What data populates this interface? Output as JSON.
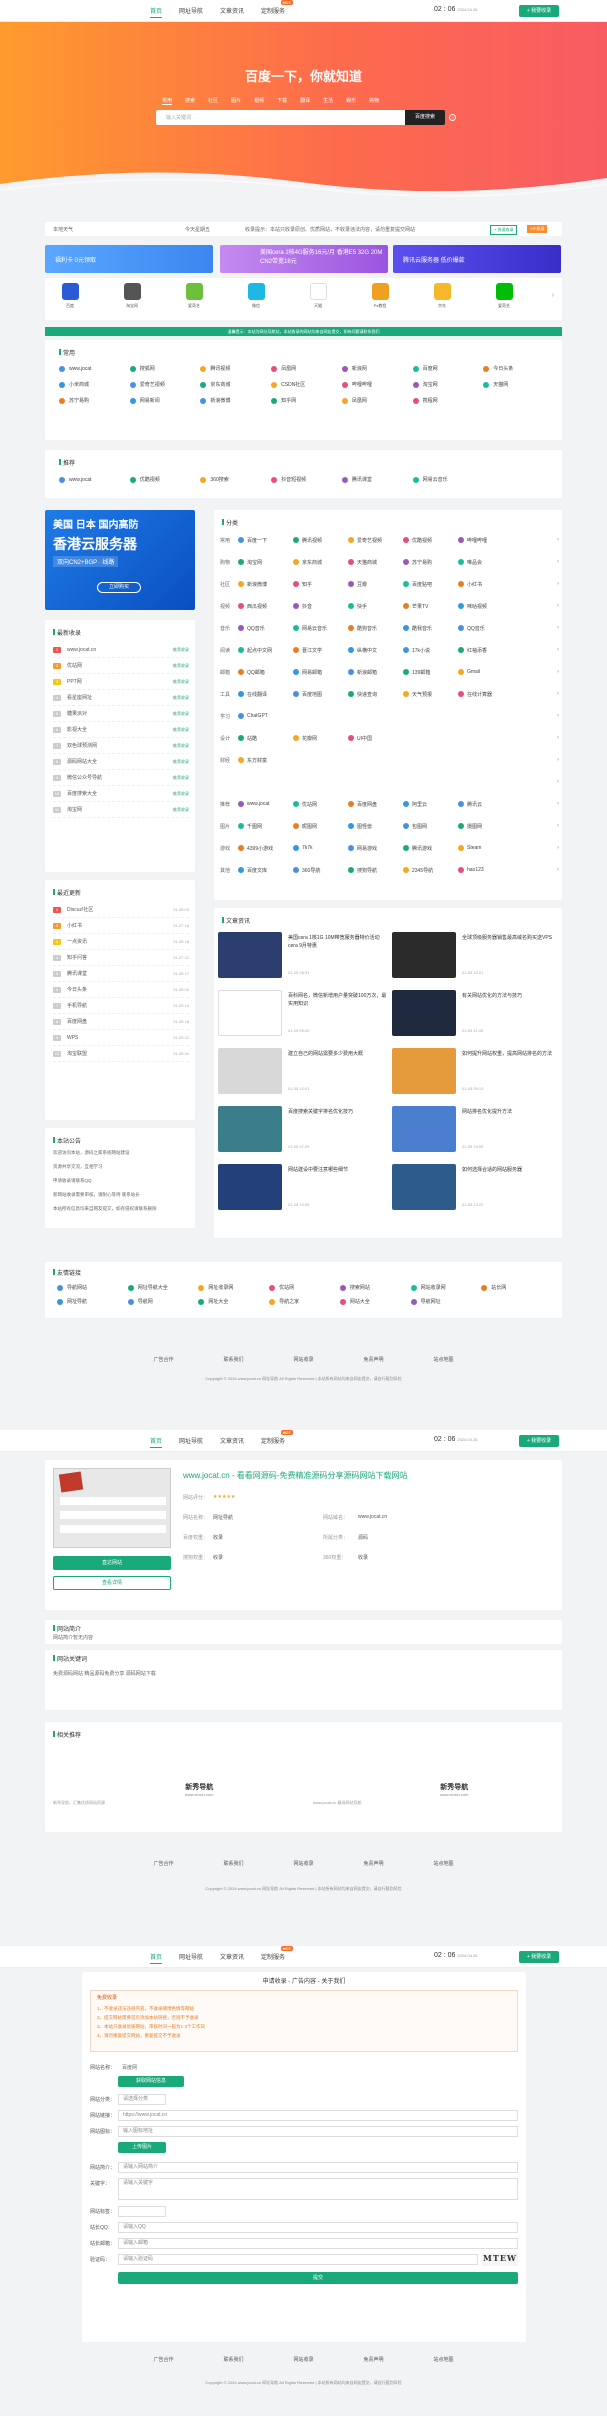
{
  "nav": {
    "items": [
      "首页",
      "网址导航",
      "文章资讯",
      "定制服务"
    ],
    "badge": "HOT",
    "time": "02 : 06",
    "date": "2024.04.26",
    "add_label": "+ 我要收录"
  },
  "hero": {
    "title": "百度一下，你就知道",
    "tabs": [
      "常用",
      "搜索",
      "社区",
      "图片",
      "视频",
      "下载",
      "翻译",
      "生活",
      "娱乐",
      "购物"
    ],
    "placeholder": "输入关键词",
    "search_btn": "百度搜索",
    "help": "?"
  },
  "strip": {
    "weather": "本地天气",
    "sign": "今天星期五",
    "notice": "收录提示：本站只收录原创、优质网站，不收录违法内容，请勿重复提交网站",
    "quick": "+ 快速收录",
    "vip": "VIP收录"
  },
  "banners": [
    {
      "text": "福利卡 0元领取",
      "color": "#3b86f0"
    },
    {
      "text": "美国cera 2核4G服务16元/月 香港E5 32G 20M CN2带宽18元",
      "color": "#9a54e0"
    },
    {
      "text": "腾讯云服务器 低价爆款",
      "color": "#4a3ee6"
    }
  ],
  "icons": [
    {
      "label": "百度",
      "color": "#2a5bd7"
    },
    {
      "label": "淘宝网",
      "color": "#ff5000"
    },
    {
      "label": "爱奇艺",
      "color": "#6dbf3d"
    },
    {
      "label": "微信",
      "color": "#1fb8e5"
    },
    {
      "label": "天猫",
      "color": "#555"
    },
    {
      "label": "Ps教程",
      "color": "#1c6ad8"
    },
    {
      "label": "京东",
      "color": "#f0a020"
    },
    {
      "label": "爱奇艺",
      "color": "#00be06"
    }
  ],
  "greenbar": "温馨提示：本站为网址导航站，本站收录的网站均来自网友提交，如有问题请联系我们",
  "common": {
    "title": "常用",
    "links": [
      "www.jocat",
      "搜狐网",
      "腾讯视频",
      "凤凰网",
      "新浪网",
      "百度网",
      "今日头条",
      "小米商城",
      "爱奇艺视频",
      "京东商城",
      "CSDN社区",
      "哔哩哔哩",
      "淘宝网",
      "天猫网",
      "苏宁易购",
      "网易新闻",
      "新浪微博",
      "知乎网",
      "凤凰网",
      "携程网"
    ]
  },
  "recommend": {
    "title": "推荐",
    "links": [
      "www.jocat",
      "优酷视频",
      "360搜索",
      "抖音短视频",
      "腾讯课堂",
      "网易云音乐"
    ]
  },
  "ad": {
    "line1": "美国 日本 国内高防",
    "line2": "香港云服务器",
    "line3": "双向CN2+BGP · 线路",
    "btn": "立即购买"
  },
  "rank1": {
    "title": "最新收录",
    "rows": [
      {
        "t": "www.jocat.cn",
        "d": "推荐收录"
      },
      {
        "t": "优站网",
        "d": "推荐收录"
      },
      {
        "t": "PPT网",
        "d": "推荐收录"
      },
      {
        "t": "看星座网址",
        "d": "推荐收录"
      },
      {
        "t": "糖果派对",
        "d": "推荐收录"
      },
      {
        "t": "影视大全",
        "d": "推荐收录"
      },
      {
        "t": "双色球预测网",
        "d": "推荐收录"
      },
      {
        "t": "源码网站大全",
        "d": "推荐收录"
      },
      {
        "t": "微信公众号导航",
        "d": "推荐收录"
      },
      {
        "t": "百度搜索大全",
        "d": "推荐收录"
      },
      {
        "t": "淘宝网",
        "d": "推荐收录"
      }
    ]
  },
  "rank2": {
    "title": "最近更新",
    "rows": [
      {
        "t": "Discuz!社区",
        "d": "01-06 03"
      },
      {
        "t": "小红书",
        "d": "01-07 16"
      },
      {
        "t": "一点资讯",
        "d": "01-08 18"
      },
      {
        "t": "知乎问答",
        "d": "01-07 22"
      },
      {
        "t": "腾讯课堂",
        "d": "01-06 17"
      },
      {
        "t": "今日头条",
        "d": "01-06 05"
      },
      {
        "t": "手机导航",
        "d": "01-05 19"
      },
      {
        "t": "百度网盘",
        "d": "01-06 18"
      },
      {
        "t": "WPS",
        "d": "01-05 22"
      },
      {
        "t": "淘宝联盟",
        "d": "01-06 20"
      }
    ]
  },
  "notices": {
    "title": "本站公告",
    "rows": [
      "欢迎访问本站，源码之家系统网站建设",
      "资源共享交流，互相学习",
      "申请收录请联系QQ",
      "新网站收录需要审核，请耐心等待 联系站长",
      "本站所有信息均来自网友提交，如有侵权请联系删除"
    ]
  },
  "categories": {
    "title": "分类",
    "rows": [
      {
        "n": "常用",
        "items": [
          "百度一下",
          "腾讯视频",
          "爱奇艺视频",
          "优酷视频",
          "哔哩哔哩"
        ]
      },
      {
        "n": "购物",
        "items": [
          "淘宝网",
          "京东商城",
          "天猫商城",
          "苏宁易购",
          "唯品会"
        ]
      },
      {
        "n": "社区",
        "items": [
          "新浪微博",
          "知乎",
          "豆瓣",
          "百度贴吧",
          "小红书"
        ]
      },
      {
        "n": "视频",
        "items": [
          "西瓜视频",
          "抖音",
          "快手",
          "芒果TV",
          "咪咕视频"
        ]
      },
      {
        "n": "音乐",
        "items": [
          "QQ音乐",
          "网易云音乐",
          "酷狗音乐",
          "酷我音乐",
          "QQ音乐"
        ]
      },
      {
        "n": "阅读",
        "items": [
          "起点中文网",
          "晋江文学",
          "纵横中文",
          "17k小说",
          "红袖添香"
        ]
      },
      {
        "n": "邮箱",
        "items": [
          "QQ邮箱",
          "网易邮箱",
          "新浪邮箱",
          "139邮箱",
          "Gmail"
        ]
      },
      {
        "n": "工具",
        "items": [
          "在线翻译",
          "百度地图",
          "快递查询",
          "天气预报",
          "在线计算器"
        ]
      },
      {
        "n": "学习",
        "items": [
          "ChatGPT",
          "",
          ""
        ]
      },
      {
        "n": "设计",
        "items": [
          "站酷",
          "花瓣网",
          "UI中国",
          "",
          ""
        ]
      },
      {
        "n": "财经",
        "items": [
          "东方财富",
          "",
          ""
        ]
      },
      {
        "n": "",
        "items": [
          "",
          ""
        ]
      },
      {
        "n": "推荐",
        "items": [
          "www.jocat",
          "优站网",
          "百度网盘",
          "阿里云",
          "腾讯云"
        ]
      },
      {
        "n": "图片",
        "items": [
          "千图网",
          "昵图网",
          "图怪兽",
          "包图网",
          "摄图网"
        ]
      },
      {
        "n": "游戏",
        "items": [
          "4399小游戏",
          "7k7k",
          "网易游戏",
          "腾讯游戏",
          "Steam"
        ]
      },
      {
        "n": "其他",
        "items": [
          "百度文库",
          "360导航",
          "搜狗导航",
          "2345导航",
          "hao123"
        ]
      }
    ]
  },
  "articles": {
    "title": "文章资讯",
    "items": [
      {
        "t": "美国cera 1核1G 10M带宽服务器特价活动cera 9月特惠",
        "d": "01-05 08:31",
        "c": "#2c3e6e"
      },
      {
        "t": "全球顶级服务器销售最高域名购买送VPS",
        "d": "01-05 10:21",
        "c": "#2b2b2b"
      },
      {
        "t": "百科网名，微信新增用户量突破100万次，最实用知识",
        "d": "01-05 09:40",
        "c": "#ffffff"
      },
      {
        "t": "有关网站优化的方法与技巧",
        "d": "01-05 11:30",
        "c": "#1f2a3f"
      },
      {
        "t": "建立自己的网站需要多少费用大概",
        "d": "01-05 12:01",
        "c": "#d8d8d8"
      },
      {
        "t": "如何提升网站权重，提高网站排名的方法",
        "d": "01-05 09:13",
        "c": "#e59a3c"
      },
      {
        "t": "百度搜索关键字排名优化技巧",
        "d": "01-05 07:29",
        "c": "#3c7d8c"
      },
      {
        "t": "网站排名优化提升方法",
        "d": "01-05 15:05",
        "c": "#4a7fd0"
      },
      {
        "t": "网站建设中要注意哪些细节",
        "d": "01-05 10:05",
        "c": "#23407a"
      },
      {
        "t": "如何选择合适的网站服务器",
        "d": "01-05 13:22",
        "c": "#2d5c8a"
      }
    ]
  },
  "friends": {
    "title": "友情链接",
    "links": [
      "导航网站",
      "网址导航大全",
      "网址收录网",
      "优站网",
      "搜索网站",
      "网站收录网",
      "站长网",
      "网址导航",
      "导航网",
      "网址大全",
      "导航之家",
      "网站大全",
      "导航网址"
    ]
  },
  "footer": {
    "links": [
      "广告合作",
      "联系我们",
      "网站收录",
      "免责声明",
      "站点地图"
    ],
    "copy": "Copyright © 2024 www.jocat.cn 网址导航 All Rights Reserved | 本站所有网站均来自网友提交，请自行甄别风险"
  },
  "detail": {
    "title": "www.jocat.cn - 看看网源码-免费精准源码分享源码网站下载网站",
    "rows": [
      [
        "网站评分：",
        "★★★★★",
        "",
        ""
      ],
      [
        "网站名称：",
        "网址导航",
        "网站域名：",
        "www.jocat.cn"
      ],
      [
        "百度权重：",
        "收录",
        "所属分类：",
        "源码"
      ],
      [
        "搜狗权重：",
        "收录",
        "360权重：",
        "收录"
      ]
    ],
    "visit": "直达网站",
    "desc_title": "网站简介",
    "desc": "网站简介暂无内容",
    "seo_title": "网站关键词",
    "seo": "免费源码网站 精品源码免费分享 源码网站下载",
    "related_title": "相关推荐",
    "rel": [
      "新秀导航",
      "新秀导航"
    ],
    "site_time": "2024.04.26 本站服务时间",
    "btn_detail": "查看详情"
  },
  "form": {
    "header": "申请收录 - 广告内容 - 关于我们",
    "notice_title": "免费收录",
    "lines": [
      "1、不收录违法违规内容，不收录赌博色情等网站",
      "2、提交网站需要首页添加本站链接，否则不予收录",
      "3、本站只收录优质网站，审核时间一般为1-3个工作日",
      "4、请勿重复提交网站，重复提交不予收录"
    ],
    "name_lbl": "网站名称：",
    "name_val": "百度网",
    "btn1": "获取网站信息",
    "domain_lbl": "网站分类：",
    "cat_val": "请选择分类",
    "url_lbl": "网站链接：",
    "url_val": "https://www.jocat.cn",
    "icon_lbl": "网站图标：",
    "icon_val": "输入图标地址",
    "icon_btn": "上传图片",
    "desc_lbl": "网站简介：",
    "desc_val": "请输入网站简介",
    "kw_lbl": "关键字：",
    "kw_val": "请输入关键字",
    "tg_lbl": "网站标签：",
    "qq_lbl": "站长QQ：",
    "qq_val": "请输入QQ",
    "email_lbl": "站长邮箱：",
    "email_val": "请输入邮箱",
    "code_lbl": "验证码：",
    "code_val": "请输入验证码",
    "captcha": "MTEW",
    "submit": "提交"
  }
}
